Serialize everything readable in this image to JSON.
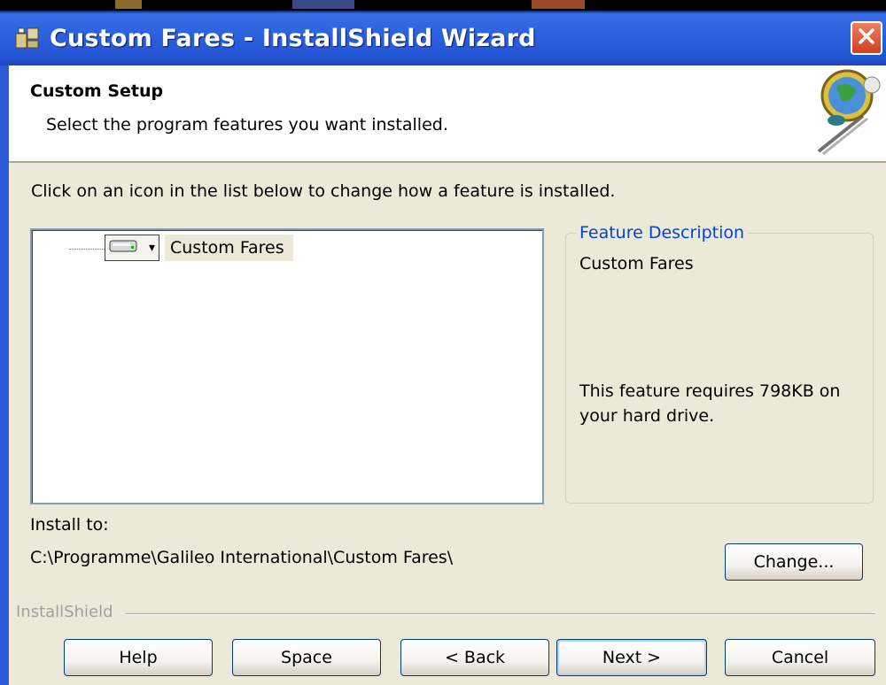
{
  "window": {
    "title": "Custom Fares - InstallShield Wizard",
    "close_symbol": "✕"
  },
  "banner": {
    "title": "Custom Setup",
    "subtitle": "Select the program features you want installed."
  },
  "instruction": "Click on an icon in the list below to change how a feature is installed.",
  "tree": {
    "items": [
      {
        "label": "Custom Fares",
        "icon": "hard-drive-icon",
        "dropdown": "▾"
      }
    ]
  },
  "feature_description": {
    "legend": "Feature Description",
    "name": "Custom Fares",
    "requirement": "This feature requires 798KB on your hard drive."
  },
  "install": {
    "label": "Install to:",
    "path": "C:\\Programme\\Galileo International\\Custom Fares\\",
    "change_label": "Change..."
  },
  "footer": {
    "brand": "InstallShield"
  },
  "buttons": {
    "help": "Help",
    "space": "Space",
    "back": "< Back",
    "next": "Next >",
    "cancel": "Cancel"
  },
  "colors": {
    "titlebar": "#2c63e0",
    "legend": "#0046d5",
    "dialog_bg": "#ece9d8"
  }
}
